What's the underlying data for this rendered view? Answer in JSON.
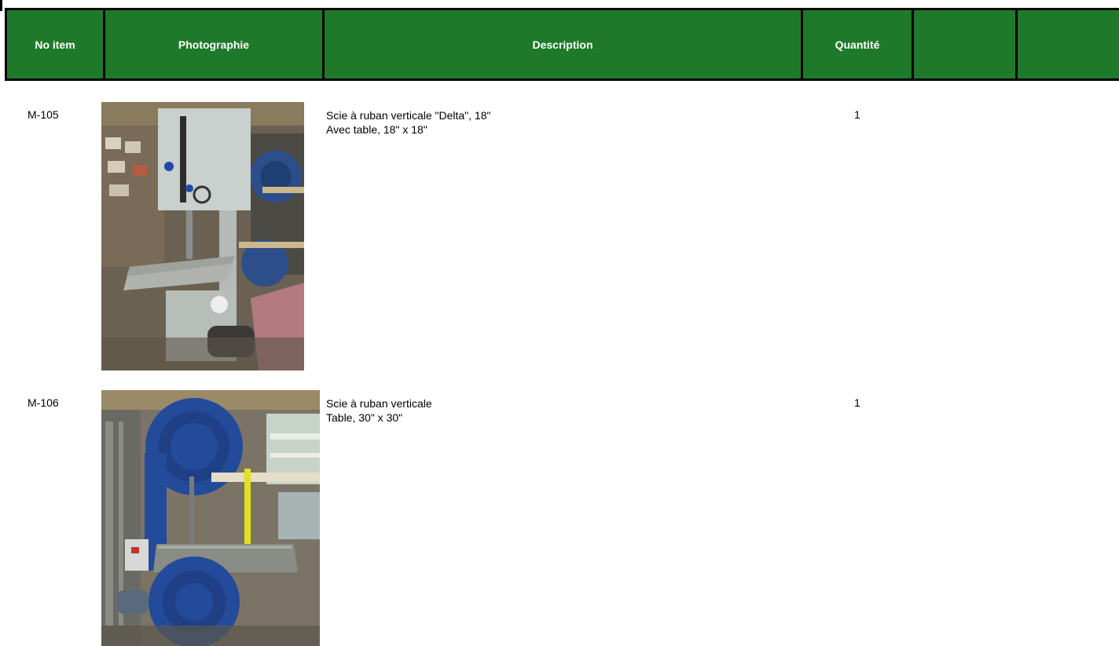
{
  "header": {
    "col_item": "No item",
    "col_photo": "Photographie",
    "col_description": "Description",
    "col_quantity": "Quantité",
    "col_5": "",
    "col_6": ""
  },
  "rows": [
    {
      "item": "M-105",
      "description_line1": "Scie à ruban verticale \"Delta\", 18\"",
      "description_line2": "Avec table, 18\" x 18\"",
      "quantity": "1",
      "photo_alt": "Scie à ruban verticale Delta"
    },
    {
      "item": "M-106",
      "description_line1": "Scie à ruban verticale",
      "description_line2": "Table, 30\" x 30\"",
      "quantity": "1",
      "photo_alt": "Scie à ruban verticale bleue"
    }
  ],
  "colors": {
    "header_bg": "#1e7a2a",
    "header_text": "#ffffff",
    "saw1_body": "#c8cfcc",
    "saw2_body": "#2a4f9a"
  }
}
